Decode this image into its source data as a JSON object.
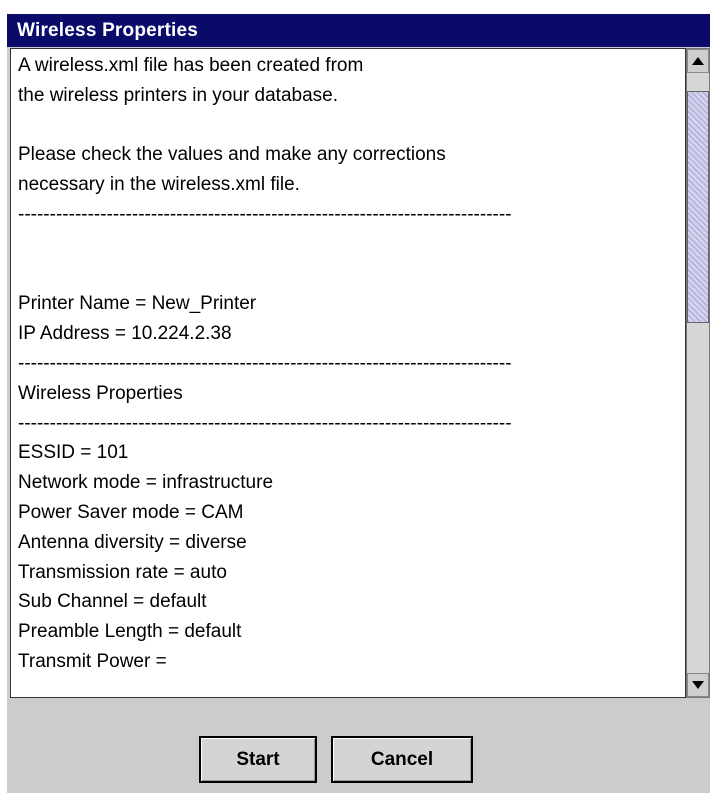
{
  "window": {
    "title": "Wireless Properties",
    "close_symbol": "✕"
  },
  "content": {
    "lines": [
      "A wireless.xml file has been created from",
      "the wireless printers in your database.",
      "",
      "Please check the values and make any corrections",
      "necessary in the wireless.xml file.",
      "------------------------------------------------------------------------------",
      "",
      "",
      "Printer Name = New_Printer",
      "IP Address = 10.224.2.38",
      "------------------------------------------------------------------------------",
      "Wireless Properties",
      "------------------------------------------------------------------------------",
      "ESSID = 101",
      "Network mode = infrastructure",
      "Power Saver mode = CAM",
      "Antenna diversity = diverse",
      "Transmission rate = auto",
      "Sub Channel = default",
      "Preamble Length = default",
      "Transmit Power ="
    ]
  },
  "buttons": {
    "start": "Start",
    "cancel": "Cancel"
  },
  "colors": {
    "titlebar": "#0a0a6b",
    "dialog_bg": "#cccccc",
    "text_bg": "#ffffff"
  }
}
